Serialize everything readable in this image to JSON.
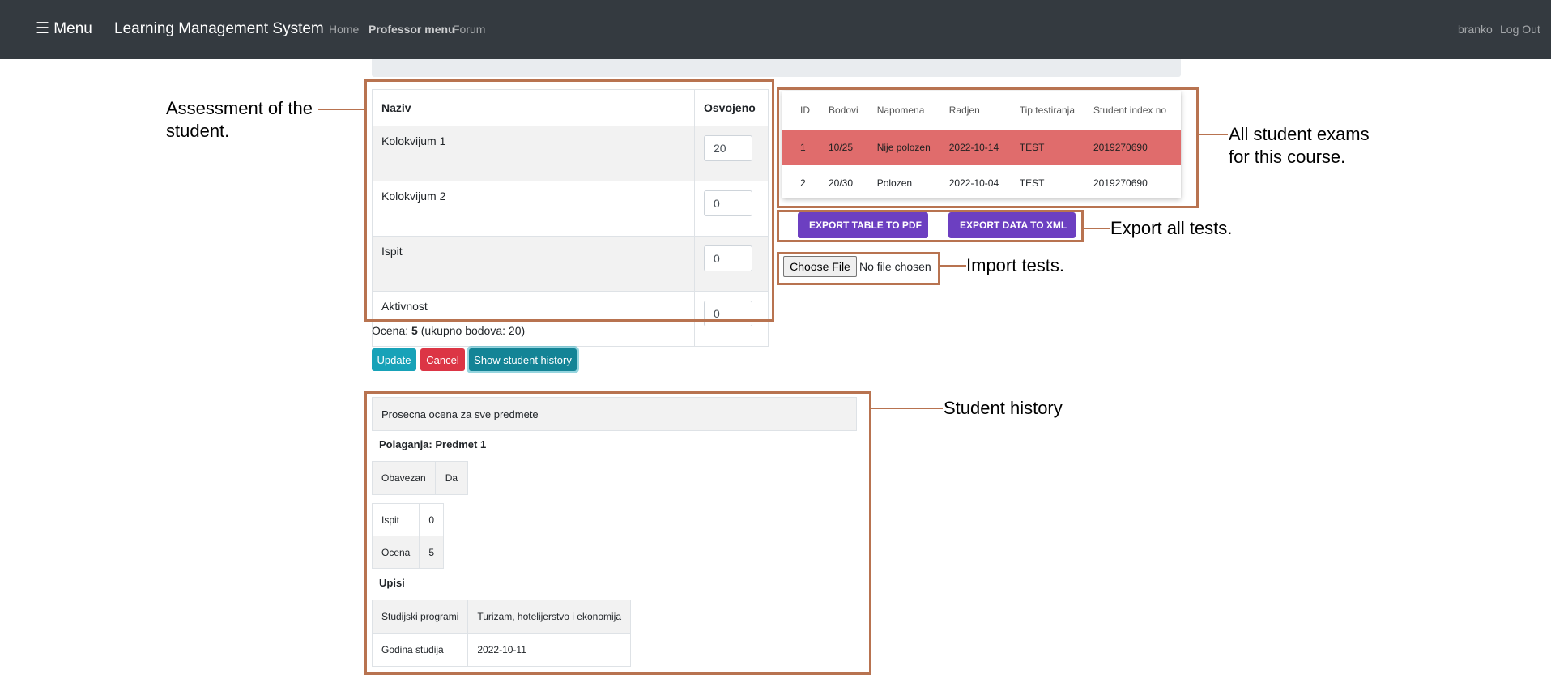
{
  "navbar": {
    "menu_label": "☰ Menu",
    "brand": "Learning Management System",
    "links": [
      "Home",
      "Professor menu",
      "Forum"
    ],
    "user": "branko",
    "logout": "Log Out"
  },
  "assessment": {
    "col_name": "Naziv",
    "col_earned": "Osvojeno",
    "rows": [
      {
        "name": "Kolokvijum 1",
        "value": "20"
      },
      {
        "name": "Kolokvijum 2",
        "value": "0"
      },
      {
        "name": "Ispit",
        "value": "0"
      },
      {
        "name": "Aktivnost",
        "value": "0"
      }
    ],
    "grade_prefix": "Ocena: ",
    "grade_value": "5",
    "grade_suffix": " (ukupno bodova: 20)"
  },
  "actions": {
    "update": "Update",
    "cancel": "Cancel",
    "history": "Show student history"
  },
  "exams": {
    "columns": [
      "ID",
      "Bodovi",
      "Napomena",
      "Radjen",
      "Tip testiranja",
      "Student index no"
    ],
    "rows": [
      [
        "1",
        "10/25",
        "Nije polozen",
        "2022-10-14",
        "TEST",
        "2019270690"
      ],
      [
        "2",
        "20/30",
        "Polozen",
        "2022-10-04",
        "TEST",
        "2019270690"
      ]
    ]
  },
  "export": {
    "pdf": "EXPORT TABLE TO PDF",
    "xml": "EXPORT DATA TO XML"
  },
  "import": {
    "choose": "Choose File",
    "status": "No file chosen"
  },
  "history": {
    "average_label": "Prosecna ocena za sve predmete",
    "average_value": "",
    "polaganja_title": "Polaganja: Predmet 1",
    "obavezan_label": "Obavezan",
    "obavezan_value": "Da",
    "ispit_label": "Ispit",
    "ispit_value": "0",
    "ocena_label": "Ocena",
    "ocena_value": "5",
    "upisi_title": "Upisi",
    "program_label": "Studijski programi",
    "program_value": "Turizam, hotelijerstvo i ekonomija",
    "year_label": "Godina studija",
    "year_value": "2022-10-11"
  },
  "annotations": {
    "assessment_line1": "Assessment of the",
    "assessment_line2": "student.",
    "exams_line1": "All student exams",
    "exams_line2": "for this course.",
    "export": "Export all tests.",
    "import": "Import tests.",
    "history": "Student history",
    "color": "#b87350"
  },
  "colors": {
    "navbar": "#343a40",
    "danger_row": "#e06c6c",
    "purple_button": "#6c3fc1",
    "info_button": "#17a2b8",
    "danger_button": "#dc3545"
  }
}
